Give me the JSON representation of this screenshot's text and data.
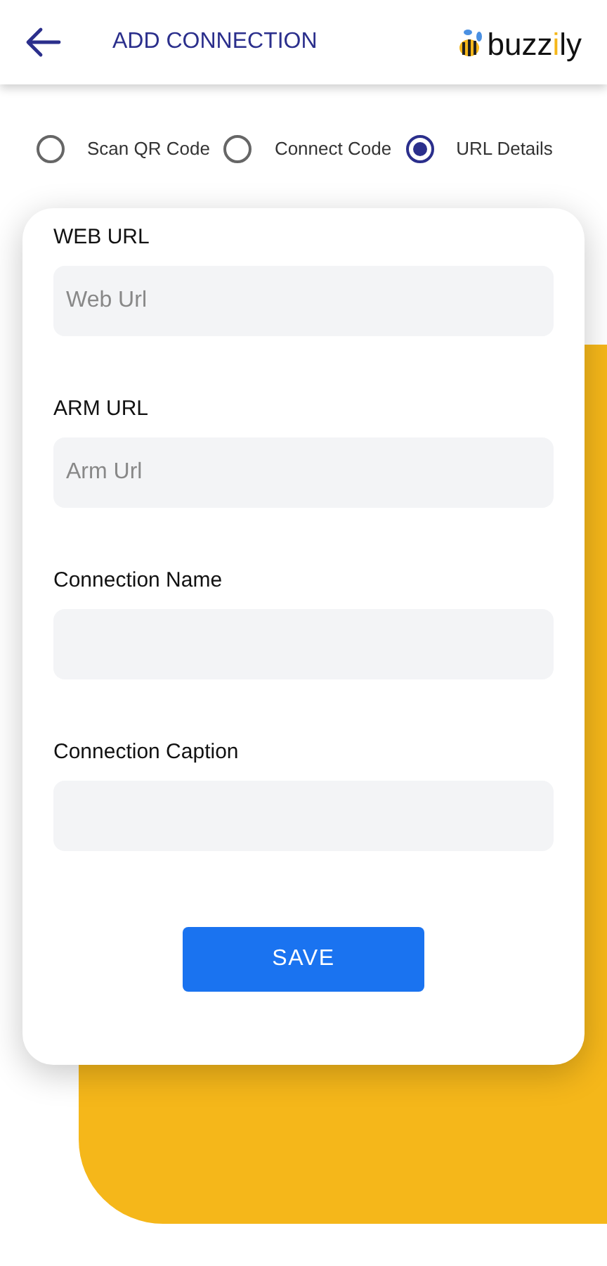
{
  "header": {
    "title": "ADD CONNECTION",
    "logo": [
      {
        "text": "buzz",
        "accent": false
      },
      {
        "text": "i",
        "accent": true
      },
      {
        "text": "ly",
        "accent": false
      }
    ]
  },
  "options": [
    {
      "label": "Scan QR Code",
      "selected": false
    },
    {
      "label": "Connect Code",
      "selected": false
    },
    {
      "label": "URL Details",
      "selected": true
    }
  ],
  "fields": [
    {
      "label": "WEB URL",
      "placeholder": "Web Url"
    },
    {
      "label": "ARM URL",
      "placeholder": "Arm Url"
    },
    {
      "label": "Connection Name"
    },
    {
      "label": "Connection Caption"
    }
  ],
  "save_button": "SAVE"
}
